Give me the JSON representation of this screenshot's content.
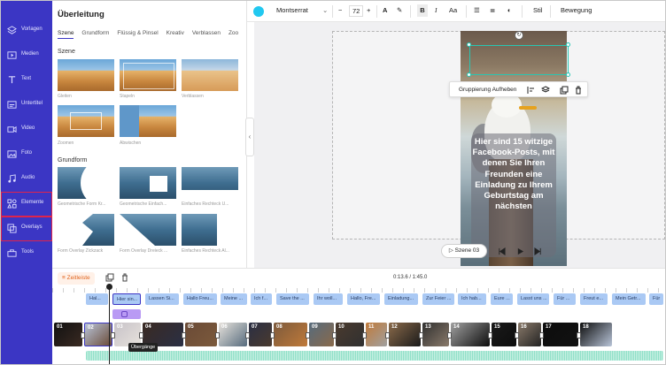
{
  "sidebar": {
    "items": [
      {
        "label": "Vorlagen",
        "icon": "layers-icon"
      },
      {
        "label": "Medien",
        "icon": "media-icon"
      },
      {
        "label": "Text",
        "icon": "text-icon"
      },
      {
        "label": "Untertitel",
        "icon": "subtitles-icon"
      },
      {
        "label": "Video",
        "icon": "video-icon"
      },
      {
        "label": "Foto",
        "icon": "photo-icon"
      },
      {
        "label": "Audio",
        "icon": "music-icon"
      },
      {
        "label": "Elemente",
        "icon": "elements-icon"
      },
      {
        "label": "Overlays",
        "icon": "overlays-icon"
      },
      {
        "label": "Tools",
        "icon": "tools-icon"
      }
    ]
  },
  "panel": {
    "title": "Überleitung",
    "tabs": [
      "Szene",
      "Grundform",
      "Flüssig & Pinsel",
      "Kreativ",
      "Verblassen",
      "Zoo"
    ],
    "section_scene": "Szene",
    "scene_items": [
      "Gleiten",
      "Stapeln",
      "Verblassen",
      "Zoomen",
      "Abwischen"
    ],
    "section_shape": "Grundform",
    "shape_items": [
      "Geometrische Form Kr...",
      "Geometrische Einfach...",
      "Einfaches Rechteck U...",
      "Form Overlay Zickzack",
      "Form Overlay Dreieck ...",
      "Einfaches Rechteck Al..."
    ]
  },
  "toolbar": {
    "font": "Montserrat",
    "font_size": "72",
    "style_label": "Stil",
    "motion_label": "Bewegung",
    "color": "#21c8f0"
  },
  "canvas": {
    "caption": "Hier sind 15 witzige Facebook-Posts, mit denen Sie Ihren Freunden eine Einladung zu Ihrem Geburtstag am nächsten",
    "context_menu_label": "Gruppierung Aufheben",
    "scene_label": "Szene 03"
  },
  "timeline": {
    "head_label": "Zeitleiste",
    "time": "0:13.6 / 1:45.0",
    "tooltip": "Übergänge",
    "text_chips": [
      "Hal...",
      "Hier sin...",
      "Lassen Si...",
      "Hallo Freu...",
      "Meine ...",
      "Ich f...",
      "Save the ...",
      "Ihr woll...",
      "Hallo, Fre...",
      "Einladung...",
      "Zur Feier ...",
      "Ich hab...",
      "Eure ...",
      "Lasst uns ...",
      "Für ...",
      "Freut e...",
      "Mein Getr...",
      "Für"
    ],
    "clips": [
      "01",
      "02",
      "03",
      "04",
      "05",
      "06",
      "07",
      "08",
      "09",
      "10",
      "11",
      "12",
      "13",
      "14",
      "15",
      "16",
      "17",
      "18"
    ]
  },
  "colors": {
    "accent": "#3b36c4",
    "selection": "#27c6b3",
    "chip": "#aac9f4",
    "highlight": "#e0244b"
  }
}
